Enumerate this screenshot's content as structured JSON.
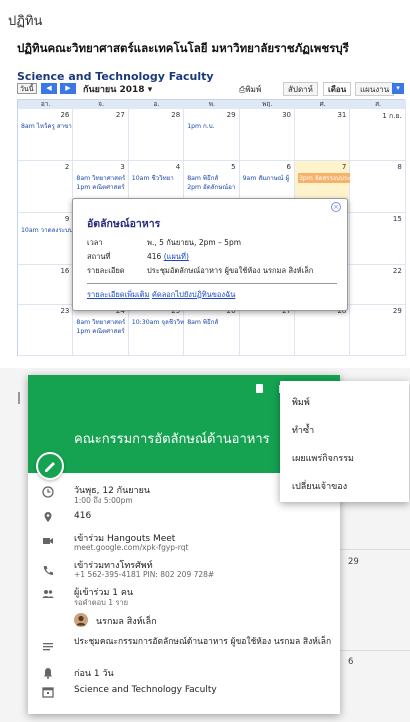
{
  "page": {
    "title": "ปฏิทิน",
    "heading": "ปฏิทินคณะวิทยาศาสตร์และเทคโนโลยี มหาวิทยาลัยราชภัฏเพชรบุรี"
  },
  "calendar": {
    "title": "Science and Technology Faculty",
    "today_label": "วันนี้",
    "month_label": "กันยายน 2018",
    "print_label": "พิมพ์",
    "tabs": [
      "สัปดาห์",
      "เดือน",
      "แผนงาน"
    ],
    "selected_tab": "เดือน",
    "weekdays": [
      "อา.",
      "จ.",
      "อ.",
      "พ.",
      "พฤ.",
      "ศ.",
      "ส."
    ],
    "weeks": [
      {
        "days": [
          "26",
          "27",
          "28",
          "29",
          "30",
          "31",
          "1 ก.ย."
        ]
      },
      {
        "days": [
          "2",
          "3",
          "4",
          "5",
          "6",
          "7",
          "8"
        ]
      },
      {
        "days": [
          "9",
          "",
          "",
          "",
          "",
          "",
          "15"
        ]
      },
      {
        "days": [
          "16",
          "",
          "",
          "",
          "",
          "",
          "22"
        ]
      },
      {
        "days": [
          "23",
          "24",
          "25",
          "26",
          "27",
          "28",
          "29"
        ]
      }
    ],
    "events": {
      "w0_sun": "8am ไหว้ครู สาขา",
      "w0_wed": "1pm ก.บ.",
      "w1_mon_1": "8am วิทยาศาสตร์",
      "w1_mon_2": "1pm คณิตศาสตร์",
      "w1_tue": "10am ชีววิทยา",
      "w1_wed_1": "8am พิธีกส์",
      "w1_wed_2": "2pm อัดลักษณ์อา",
      "w1_thu": "9am สัมภาษณ์ ผู้",
      "w1_fri": "3pm จัดสรรงบประ",
      "w2_sun": "10am วาดลงระบบ",
      "w2_mon": "8am",
      "w2_mon_2": "1pm",
      "w3_mon": "8am",
      "w3_mon_2": "1pm",
      "w4_mon_1": "8am วิทยาศาสตร์",
      "w4_mon_2": "1pm คณิตศาสตร์",
      "w4_tue": "10:30am จุลชีววิทยา",
      "w4_wed": "8am พิธีกส์"
    },
    "highlight_color": "#fff3cc"
  },
  "bubble": {
    "title": "อัตลักษณ์อาหาร",
    "close": "×",
    "when_label": "เวลา",
    "when_value": "พ., 5 กันยายน, 2pm – 5pm",
    "where_label": "สถานที่",
    "where_value": "416",
    "map_link": "(แผนที่)",
    "desc_label": "รายละเอียด",
    "desc_value": "ประชุมอัตลักษณ์อาหาร ผู้ขอใช้ห้อง นรกมล สิงห์เล็ก",
    "more_link": "รายละเอียดเพิ่มเติม",
    "copy_link": "คัดลอกไปยังปฏิทินของฉัน"
  },
  "event_card": {
    "title": "คณะกรรมการอัตลักษณ์ด้านอาหาร",
    "date": "วันพุธ, 12 กันยายน",
    "time": "1:00 ถึง 5:00pm",
    "room": "416",
    "meet_label": "เข้าร่วม Hangouts Meet",
    "meet_link": "meet.google.com/xpk-fgyp-rqt",
    "phone_label": "เข้าร่วมทางโทรศัพท์",
    "phone_value": "+1 562-395-4181 PIN: 802 209 728#",
    "guests_label": "ผู้เข้าร่วม 1 คน",
    "guests_sub": "รอคำตอบ 1 ราย",
    "guest_name": "นรกมล สิงห์เล็ก",
    "description": "ประชุมคณะกรรมการอัตลักษณ์ด้านอาหาร ผู้ขอใช้ห้อง นรกมล สิงห์เล็ก",
    "reminder": "ก่อน 1 วัน",
    "calendar_name": "Science and Technology Faculty",
    "header_color": "#15a352"
  },
  "background": {
    "day_29": "29",
    "day_6": "6"
  },
  "menu": {
    "items": [
      "พิมพ์",
      "ทำซ้ำ",
      "เผยแพร่กิจกรรม",
      "เปลี่ยนเจ้าของ"
    ]
  }
}
